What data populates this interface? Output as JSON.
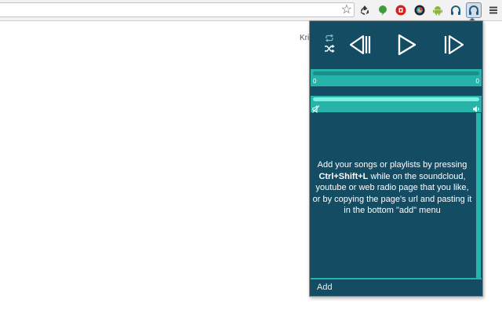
{
  "browser": {
    "bookmark_icon": "star-icon",
    "extensions": [
      "recycle-icon",
      "evernote-icon",
      "stop-icon",
      "color-wheel-icon",
      "android-icon",
      "headphones-icon",
      "headphones-active-icon"
    ],
    "menu_icon": "hamburger-icon"
  },
  "page": {
    "partial_text": "Kri"
  },
  "player": {
    "controls": {
      "repeat_icon": "repeat-icon",
      "shuffle_icon": "shuffle-icon",
      "prev_icon": "previous-icon",
      "play_icon": "play-icon",
      "next_icon": "next-icon"
    },
    "progress": {
      "current_time": "0",
      "total_time": "0",
      "fraction": 0
    },
    "volume": {
      "fraction": 1.0,
      "mute_icon": "mute-icon",
      "max_icon": "volume-icon"
    },
    "playlist": {
      "empty_msg_before": "Add your songs or playlists by pressing ",
      "shortcut": "Ctrl+Shift+L",
      "empty_msg_after": " while on the soundcloud, youtube or web radio page that you like, or by copying the page's url and pasting it in the bottom \"add\" menu"
    },
    "add_label": "Add"
  },
  "colors": {
    "popup_bg": "#134c63",
    "accent": "#25b3aa",
    "text": "#ffffff"
  }
}
